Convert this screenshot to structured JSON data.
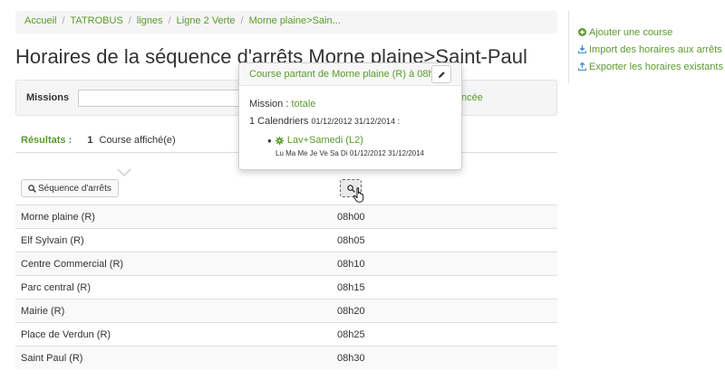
{
  "breadcrumb": [
    "Accueil",
    "TATROBUS",
    "lignes",
    "Ligne 2 Verte",
    "Morne plaine>Sain..."
  ],
  "page_title": "Horaires de la séquence d'arrêts Morne plaine>Saint-Paul",
  "filter": {
    "label": "Missions",
    "input_value": "",
    "advanced_partial": "ncée"
  },
  "results": {
    "label": "Résultats :",
    "count": "1",
    "suffix": "Course affiché(e)"
  },
  "sequence_button": "Séquence d'arrêts",
  "stops": [
    {
      "name": "Morne plaine (R)",
      "time": "08h00"
    },
    {
      "name": "Elf Sylvain (R)",
      "time": "08h05"
    },
    {
      "name": "Centre Commercial (R)",
      "time": "08h10"
    },
    {
      "name": "Parc central (R)",
      "time": "08h15"
    },
    {
      "name": "Mairie (R)",
      "time": "08h20"
    },
    {
      "name": "Place de Verdun (R)",
      "time": "08h25"
    },
    {
      "name": "Saint Paul (R)",
      "time": "08h30"
    }
  ],
  "side_actions": [
    {
      "icon": "plus-circle-icon",
      "label": "Ajouter une course"
    },
    {
      "icon": "download-icon",
      "label": "Import des horaires aux arrêts"
    },
    {
      "icon": "upload-icon",
      "label": "Exporter les horaires existants"
    }
  ],
  "popover": {
    "title": "Course partant de Morne plaine (R) à 08h00",
    "mission_label": "Mission :",
    "mission_value": "totale",
    "calendars_text": "1 Calendriers",
    "calendars_dates": "01/12/2012 31/12/2014 :",
    "calendar_name": "Lav+Samedi (L2)",
    "calendar_days": "Lu Ma Me Je Ve Sa Di",
    "calendar_dates": "01/12/2012 31/12/2014"
  },
  "colors": {
    "accent_green": "#5a9a2c",
    "download_blue": "#3a8fd0"
  }
}
